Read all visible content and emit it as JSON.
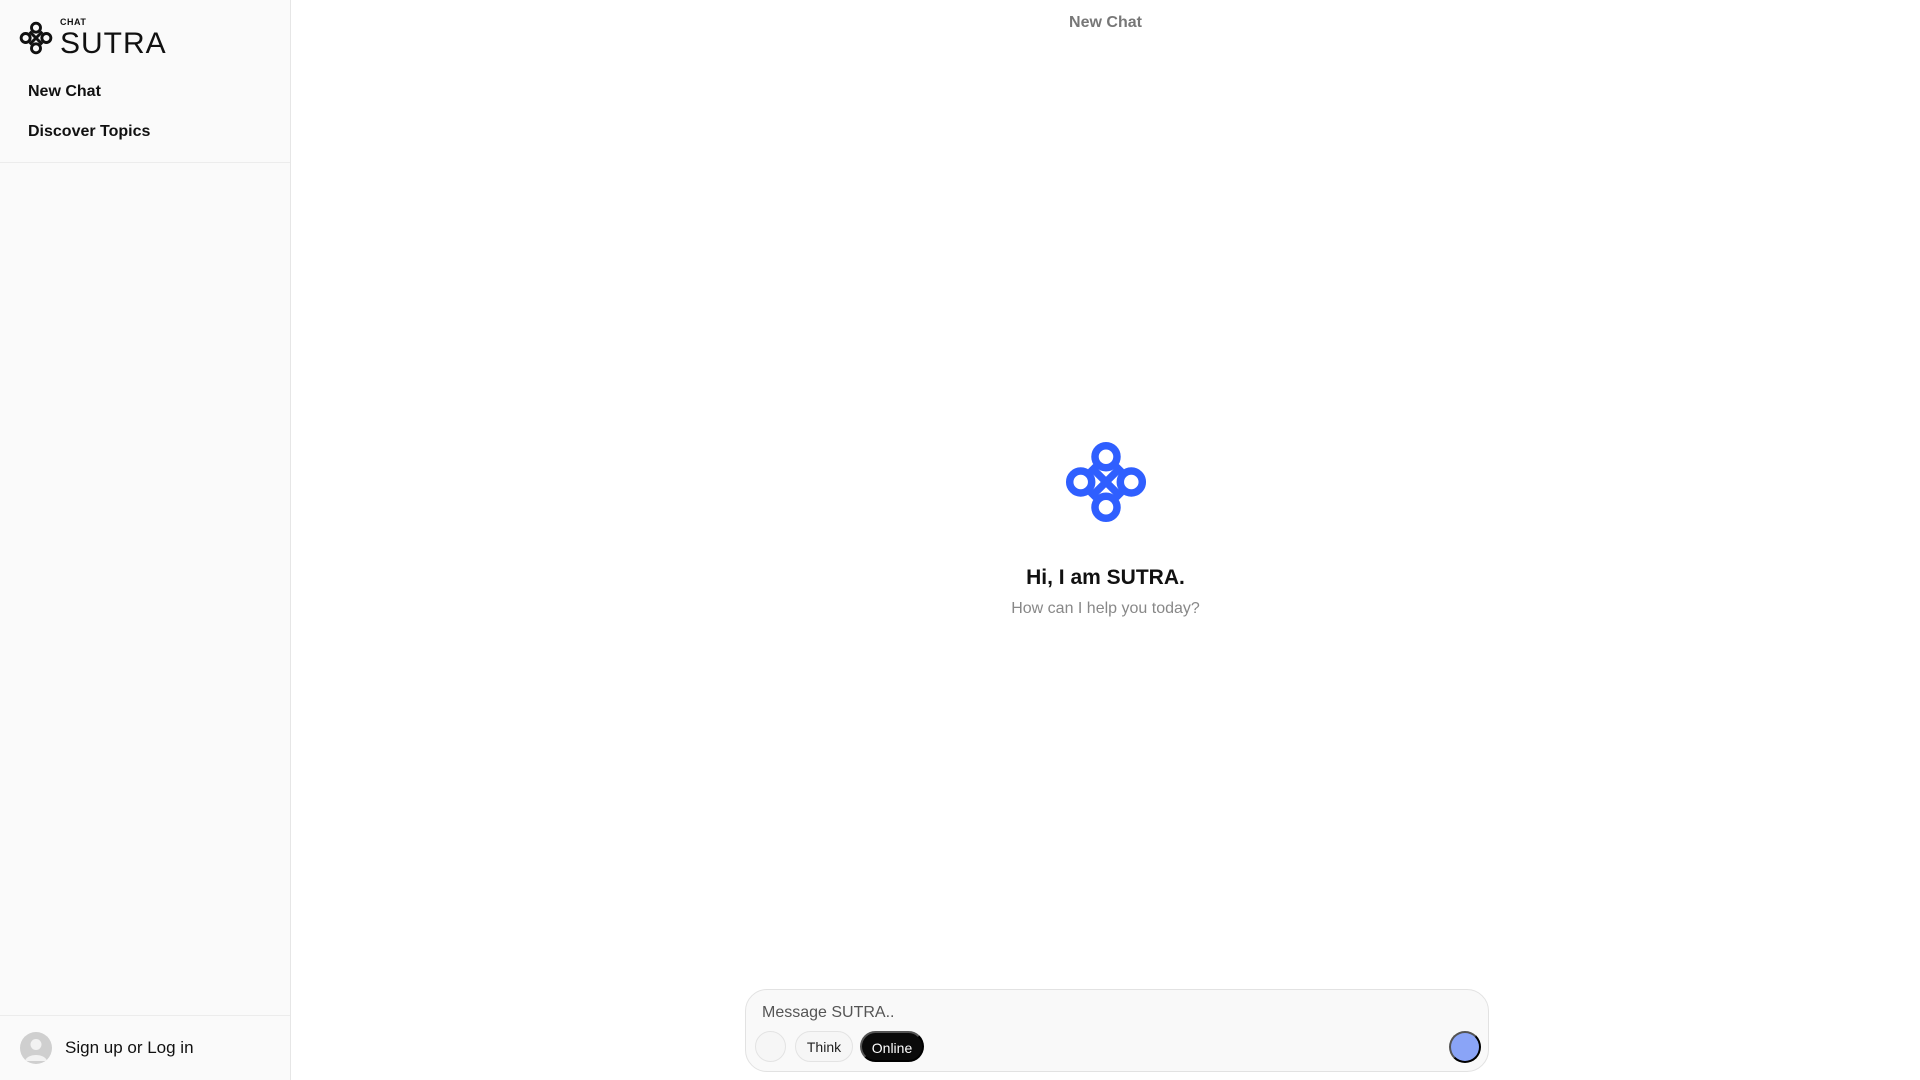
{
  "brand": {
    "small": "CHAT",
    "big": "SUTRA",
    "accent_color": "#2f5fff",
    "logo_icon": "knot-logo-icon"
  },
  "sidebar": {
    "items": [
      {
        "label": "New Chat"
      },
      {
        "label": "Discover Topics"
      }
    ],
    "footer": {
      "label": "Sign up or Log in",
      "avatar_icon": "user-avatar-icon"
    }
  },
  "main": {
    "title": "New Chat",
    "greeting": "Hi, I am SUTRA.",
    "subtext": "How can I help you today?"
  },
  "composer": {
    "placeholder": "Message SUTRA..",
    "value": "",
    "think_label": "Think",
    "online_label": "Online",
    "online_active": true,
    "send_color": "#8aa4f7"
  }
}
